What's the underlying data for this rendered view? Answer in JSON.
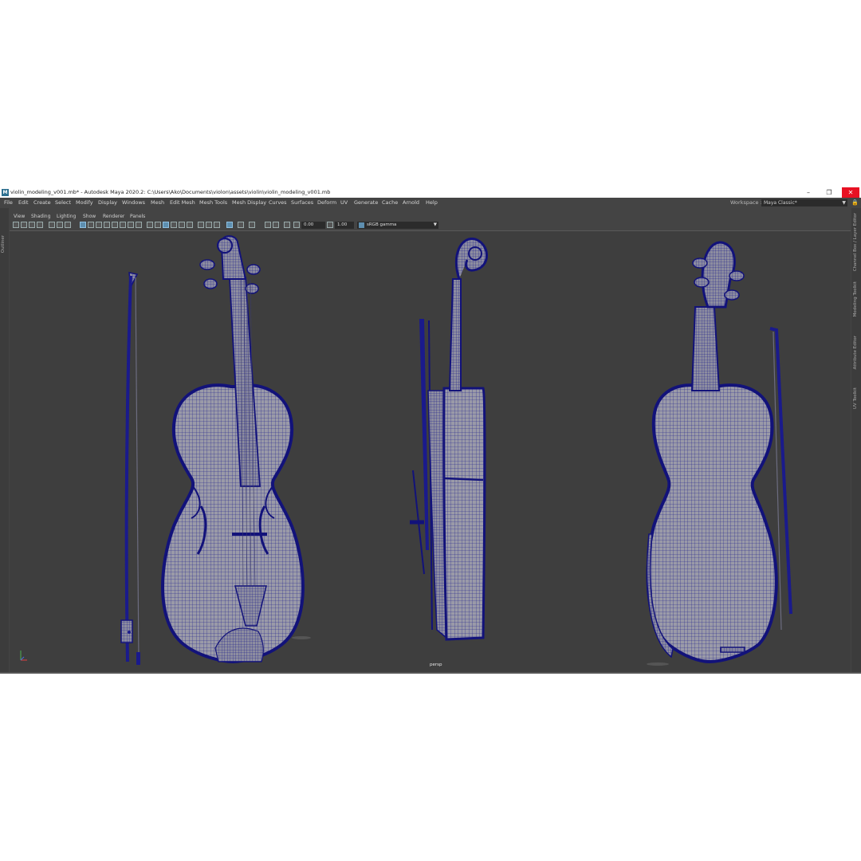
{
  "window": {
    "title": "violin_modeling_v001.mb* - Autodesk Maya 2020.2: C:\\Users\\Ako\\Documents\\violon\\assets\\violin\\violin_modeling_v001.mb",
    "app_icon": "M",
    "controls": {
      "minimize": "–",
      "maximize": "❐",
      "close": "✕"
    }
  },
  "menubar": {
    "items": [
      "File",
      "Edit",
      "Create",
      "Select",
      "Modify",
      "Display",
      "Windows",
      "Mesh",
      "Edit Mesh",
      "Mesh Tools",
      "Mesh Display",
      "Curves",
      "Surfaces",
      "Deform",
      "UV",
      "Generate",
      "Cache",
      "Arnold",
      "Help"
    ],
    "workspace_label": "Workspace :",
    "workspace_value": "Maya Classic*"
  },
  "left_panel": {
    "outliner_tab": "Outliner"
  },
  "right_panel": {
    "tabs": [
      "Channel Box / Layer Editor",
      "Modeling Toolkit",
      "Attribute Editor",
      "UV Toolkit"
    ]
  },
  "panel_menu": {
    "items": [
      "View",
      "Shading",
      "Lighting",
      "Show",
      "Renderer",
      "Panels"
    ]
  },
  "toolbar": {
    "exposure": "0.00",
    "gamma": "1.00",
    "color_management": "sRGB gamma"
  },
  "viewport": {
    "camera": "persp",
    "background_color": "#3e3e3e",
    "wire_color": "#1a1a8c",
    "mesh_color": "#9a9aa8"
  }
}
